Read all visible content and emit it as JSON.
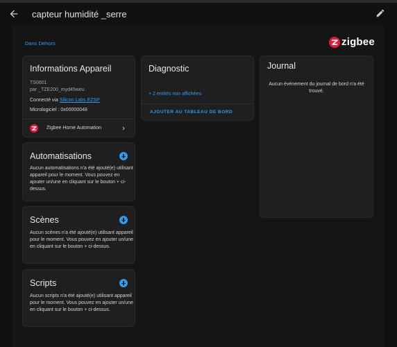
{
  "header": {
    "title": "capteur humidité _serre"
  },
  "area_link": "Dans Dehors",
  "brand": {
    "name": "zigbee",
    "color": "#e8173c"
  },
  "device_info": {
    "title": "Informations Appareil",
    "model": "TS0601",
    "manufacturer": "par _TZE200_myd45weu",
    "connected_prefix": "Connecté via ",
    "connected_link": "Silicon Labs EZSP",
    "firmware": "Micrologiciel : 0x00000048",
    "integration": "Zigbee Home Automation"
  },
  "automations": {
    "title": "Automatisations",
    "description": "Aucun automatisations n'a été ajouté(e) utilisant appareil pour le moment. Vous pouvez en ajouter un/une en cliquant sur le bouton + ci-dessus."
  },
  "scenes": {
    "title": "Scènes",
    "description": "Aucun scènes n'a été ajouté(e) utilisant appareil pour le moment. Vous pouvez en ajouter un/une en cliquant sur le bouton + ci-dessus."
  },
  "scripts": {
    "title": "Scripts",
    "description": "Aucun scripts n'a été ajouté(e) utilisant appareil pour le moment. Vous pouvez en ajouter un/une en cliquant sur le bouton + ci-dessus."
  },
  "diagnostic": {
    "title": "Diagnostic",
    "hidden_entities": "+ 2 entités non affichées",
    "add_to_dashboard": "AJOUTER AU TABLEAU DE BORD"
  },
  "logbook": {
    "title": "Journal",
    "empty": "Aucun événement du journal de bord n'a été trouvé."
  },
  "colors": {
    "accent": "#2f9cf0",
    "background": "#111111",
    "card": "#1f1f1f"
  }
}
